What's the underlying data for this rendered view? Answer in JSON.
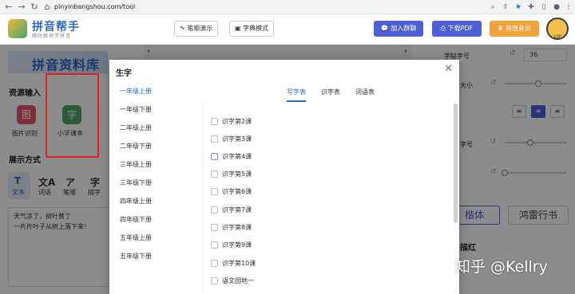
{
  "browser": {
    "url": "pinyinbangshou.com/tool",
    "back_icon": "arrow-left-icon",
    "forward_icon": "arrow-right-icon",
    "reload_icon": "reload-icon",
    "home_icon": "home-icon"
  },
  "header": {
    "app_title": "拼音帮手",
    "app_subtitle": "随时随地学拼音",
    "mode_buttons": [
      "笔顺演示",
      "字典模式"
    ],
    "join_group": "加入群聊",
    "download_pdf": "下载PDF",
    "recharge": "充值会员",
    "vip_badge": "VIP",
    "colors": {
      "join": "#4c5fd5",
      "pdf": "#4c5fd5",
      "recharge": "#f0a23b"
    }
  },
  "left_panel": {
    "banner": "拼音资料库",
    "resource_title": "资源输入",
    "resources": [
      {
        "label": "图片识别",
        "glyph": "图",
        "color": "#e8566e"
      },
      {
        "label": "小学课本",
        "glyph": "字",
        "color": "#52a86b"
      }
    ],
    "display_title": "展示方式",
    "display_modes": [
      {
        "label": "文本",
        "glyph": "T"
      },
      {
        "label": "词语",
        "glyph": "文A"
      },
      {
        "label": "笔顺",
        "glyph": "ア"
      },
      {
        "label": "描字",
        "glyph": "字"
      }
    ],
    "text_lines": [
      "天气凉了，树叶黄了",
      "一片片叶子从树上落下来！"
    ]
  },
  "right_panel": {
    "font_size_label": "字帖字号",
    "font_size_value": "36",
    "size_label": "大小",
    "pinyin_size_label": "字号",
    "font_options": [
      "楷体",
      "鸿雷行书"
    ],
    "trace_label": "描红"
  },
  "modal": {
    "title": "生字",
    "grades": [
      "一年级上册",
      "一年级下册",
      "二年级上册",
      "二年级下册",
      "三年级上册",
      "三年级下册",
      "四年级上册",
      "四年级下册",
      "五年级上册",
      "五年级下册"
    ],
    "active_grade": 0,
    "tabs": [
      "写字表",
      "识字表",
      "词语表"
    ],
    "active_tab": 0,
    "lessons": [
      "识字第2课",
      "识字第3课",
      "识字第4课",
      "识字第5课",
      "识字第6课",
      "识字第7课",
      "识字第8课",
      "识字第9课",
      "识字第10课",
      "语文园地一"
    ]
  },
  "watermark": "知乎 @Kellry"
}
